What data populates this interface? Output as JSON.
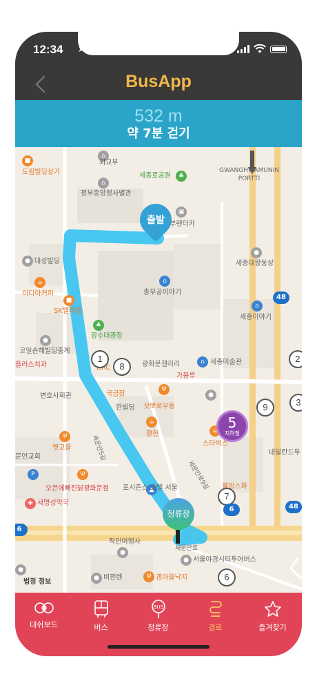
{
  "status_bar": {
    "time": "12:34"
  },
  "nav": {
    "title": "BusApp"
  },
  "route": {
    "distance": "532 m",
    "walk_time": "약 7분 걷기"
  },
  "map": {
    "labels": {
      "dorip": "도림빌딩상가",
      "oegyobu": "외교부",
      "sejongro_park": "세종로공원",
      "gov_complex": "정부중앙청사별관",
      "gwanghwamun_portti": "GWANGHWAMUNIN\nPORTTI",
      "rentacar": "동부렌터카",
      "daesung": "대성빌딩",
      "sejong_daewang": "세종대왕동상",
      "idea_coffee": "이디아커피",
      "choong_mu": "충무공이야기",
      "sk_tel": "SK텔레콤",
      "sejong_story": "세종이야기",
      "sejong_square": "광수대광장",
      "korean_dental": "코일손해빌딩중계",
      "plus_dental": "플러스치과",
      "gallery": "광화문갤러리",
      "art_museum": "세종미술관",
      "brc": "BRC",
      "bank": "가봉루",
      "jamsil": "국금장",
      "bunsik": "변호사회관",
      "hotel": "한빌딩",
      "sapporo": "삿뽀로우동",
      "yeunggo": "옛고을",
      "hyanghwon": "향헌",
      "starbucks": "스타벅스",
      "nedeland": "네덜란드투",
      "ruangyo": "문안교회",
      "sewoon": "세운안5길",
      "sejongro9": "세문안로9길",
      "ohbun": "오픈에빠진닭광화문점",
      "four_seasons": "포시즌스 호텔 서울",
      "wellbeing": "웰빙스파",
      "saemyung": "새명성약국",
      "stop_label": "정류장",
      "jakin": "작인여행사",
      "tour_bus": "서울야경시티투어버스",
      "sinmunro": "새문안로",
      "beopjeong": "법정 정보",
      "bijeonren": "비전렌",
      "gaemalbak": "갬마을낙지",
      "jiha": "지하철",
      "start_pin": "출발",
      "stop_pin": "정류장"
    },
    "stop_numbers": [
      "1",
      "8",
      "2",
      "5",
      "9",
      "3",
      "7",
      "6"
    ],
    "road_shields": [
      "48",
      "48",
      "6",
      "6"
    ]
  },
  "tabs": [
    {
      "label": "대쉬보드",
      "icon": "dashboard-icon",
      "active": false
    },
    {
      "label": "버스",
      "icon": "bus-icon",
      "active": false
    },
    {
      "label": "정류장",
      "icon": "bus-stop-icon",
      "active": false
    },
    {
      "label": "경로",
      "icon": "route-icon",
      "active": true
    },
    {
      "label": "즐겨찾기",
      "icon": "star-icon",
      "active": false
    }
  ],
  "colors": {
    "bar_dark": "#3a3937",
    "title_yellow": "#f2b84b",
    "banner_blue": "#2aa4c8",
    "route_blue": "#3ec4f0",
    "tab_red": "#e04456",
    "tab_active": "#f8c76a"
  }
}
